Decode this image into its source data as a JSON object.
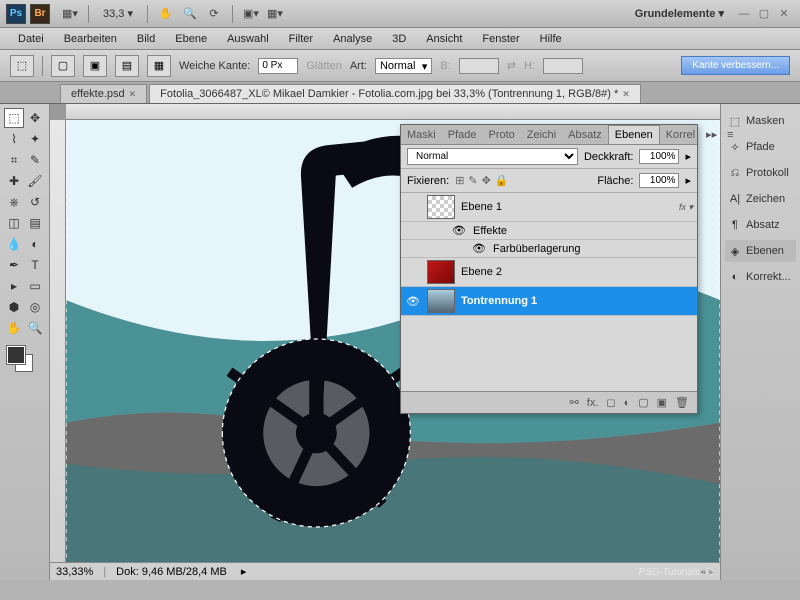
{
  "workspace_label": "Grundelemente ▾",
  "zoom_display": "33,3 ▾",
  "menu": [
    "Datei",
    "Bearbeiten",
    "Bild",
    "Ebene",
    "Auswahl",
    "Filter",
    "Analyse",
    "3D",
    "Ansicht",
    "Fenster",
    "Hilfe"
  ],
  "options": {
    "feather_label": "Weiche Kante:",
    "feather_value": "0 Px",
    "antialias_label": "Glätten",
    "art_label": "Art:",
    "art_value": "Normal",
    "b_label": "B:",
    "h_label": "H:",
    "enhance": "Kante verbessern..."
  },
  "tabs": [
    {
      "label": "effekte.psd",
      "active": false
    },
    {
      "label": "Fotolia_3066487_XL© Mikael Damkier - Fotolia.com.jpg bei 33,3% (Tontrennung 1, RGB/8#) *",
      "active": true
    }
  ],
  "status": {
    "zoom": "33,33%",
    "doc": "Dok: 9,46 MB/28,4 MB"
  },
  "dock": [
    {
      "icon": "⬚",
      "label": "Masken",
      "name": "dock-masks"
    },
    {
      "icon": "✧",
      "label": "Pfade",
      "name": "dock-paths"
    },
    {
      "icon": "⎌",
      "label": "Protokoll",
      "name": "dock-history"
    },
    {
      "icon": "A|",
      "label": "Zeichen",
      "name": "dock-character"
    },
    {
      "icon": "¶",
      "label": "Absatz",
      "name": "dock-paragraph"
    },
    {
      "icon": "◈",
      "label": "Ebenen",
      "name": "dock-layers",
      "selected": true
    },
    {
      "icon": "◐",
      "label": "Korrekt...",
      "name": "dock-adjust"
    }
  ],
  "panel": {
    "tabs": [
      "Maski",
      "Pfade",
      "Proto",
      "Zeichi",
      "Absatz",
      "Ebenen",
      "Korrel"
    ],
    "active_tab": "Ebenen",
    "blend_mode": "Normal",
    "opacity_label": "Deckkraft:",
    "opacity_value": "100%",
    "lock_label": "Fixieren:",
    "fill_label": "Fläche:",
    "fill_value": "100%",
    "layers": [
      {
        "name": "Ebene 1",
        "thumb": "checker",
        "fx": true
      },
      {
        "name": "Effekte",
        "sub": true,
        "eye": true
      },
      {
        "name": "Farbüberlagerung",
        "sub": true,
        "eye": true,
        "indent": true
      },
      {
        "name": "Ebene 2",
        "thumb": "red"
      },
      {
        "name": "Tontrennung 1",
        "thumb": "img",
        "eye": true,
        "selected": true
      }
    ]
  },
  "watermark": "PSD-Tutorials.de"
}
